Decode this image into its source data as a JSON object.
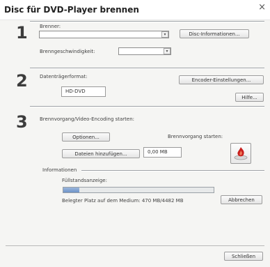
{
  "window": {
    "title": "Disc für DVD-Player brennen",
    "close_glyph": "×"
  },
  "step1": {
    "number": "1",
    "burner_label": "Brenner:",
    "burner_value": "",
    "disc_info_button": "Disc-Informationen...",
    "speed_label": "Brenngeschwindigkeit:",
    "speed_value": ""
  },
  "step2": {
    "number": "2",
    "format_label": "Datenträgerformat:",
    "format_value": "HD-DVD",
    "encoder_button": "Encoder-Einstellungen...",
    "help_button": "Hilfe..."
  },
  "step3": {
    "number": "3",
    "heading": "Brennvorgang/Video-Encoding starten:",
    "options_button": "Optionen...",
    "burn_label": "Brennvorgang starten:",
    "add_files_button": "Dateien hinzufügen...",
    "size_value": "0,00 MB"
  },
  "info": {
    "heading": "Informationen",
    "fill_label": "Füllstandsanzeige:",
    "fill_fraction": 0.105,
    "used_space": "Belegter Platz auf dem Medium: 470 MB/4482 MB",
    "cancel_button": "Abbrechen"
  },
  "footer": {
    "close_button": "Schließen"
  },
  "colors": {
    "progress": "#7a9bd0",
    "burn_icon": "#c8201e"
  }
}
